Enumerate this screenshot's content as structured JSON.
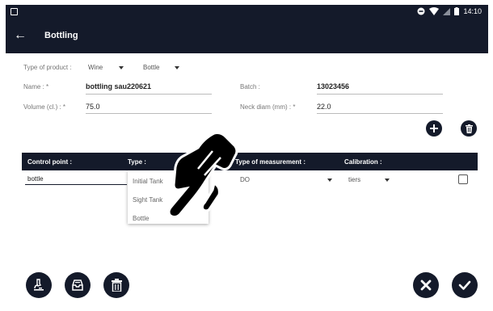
{
  "status_bar": {
    "time": "14:10"
  },
  "app_bar": {
    "back_icon": "arrow-left-icon",
    "title": "Bottling"
  },
  "form": {
    "type_of_product_label": "Type of product :",
    "product_value": "Wine",
    "container_value": "Bottle",
    "name_label": "Name : *",
    "name_value": "bottling sau220621",
    "batch_label": "Batch :",
    "batch_value": "13023456",
    "volume_label": "Volume (cl.) : *",
    "volume_value": "75.0",
    "neck_label": "Neck diam (mm) : *",
    "neck_value": "22.0"
  },
  "actions": {
    "add_icon": "plus-icon",
    "delete_icon": "trash-icon"
  },
  "table": {
    "headers": {
      "control_point": "Control point :",
      "type": "Type :",
      "measurement": "Type of measurement :",
      "calibration": "Calibration :"
    },
    "row": {
      "control_point": "bottle",
      "measurement": "DO",
      "calibration": "tiers",
      "checked": false
    }
  },
  "type_dropdown": {
    "options": [
      "Initial Tank",
      "Sight Tank",
      "Bottle"
    ]
  },
  "bottom_bar": {
    "left_icons": [
      "microscope-icon",
      "inbox-icon",
      "trash-icon"
    ],
    "right_icons": [
      "cancel-icon",
      "confirm-icon"
    ]
  },
  "colors": {
    "dark": "#141a2a",
    "white": "#ffffff"
  }
}
